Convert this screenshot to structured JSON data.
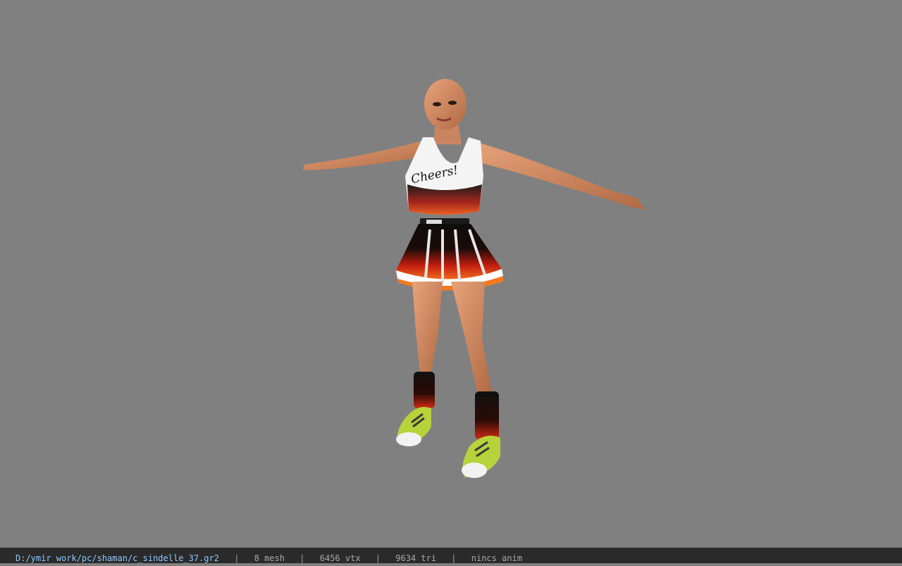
{
  "viewer": {
    "background_color": "#808080",
    "model_description_icon": "character-model"
  },
  "status_bar": {
    "file_path": "D:/ymir work/pc/shaman/c_sindelle_37.gr2",
    "separator": "|",
    "mesh_count": "8 mesh",
    "vertex_count": "6456 vtx",
    "triangle_count": "9634 tri",
    "anim_status": "nincs anim"
  },
  "model": {
    "top_text": "Cheers!"
  }
}
